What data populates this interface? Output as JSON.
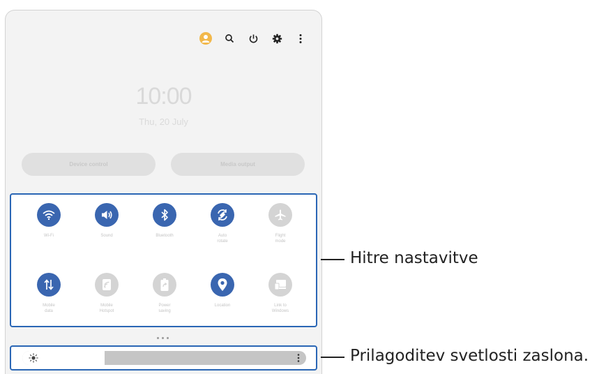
{
  "header_icons": [
    {
      "name": "profile-icon"
    },
    {
      "name": "search-icon"
    },
    {
      "name": "power-icon"
    },
    {
      "name": "gear-icon"
    },
    {
      "name": "more-vertical-icon"
    }
  ],
  "clock": {
    "time": "10:00",
    "date": "Thu, 20 July"
  },
  "pills": {
    "left": "Device control",
    "right": "Media output"
  },
  "quick_settings": {
    "tiles": [
      {
        "label": "Wi-Fi",
        "icon": "wifi-icon",
        "active": true
      },
      {
        "label": "Sound",
        "icon": "sound-icon",
        "active": true
      },
      {
        "label": "Bluetooth",
        "icon": "bluetooth-icon",
        "active": true
      },
      {
        "label": "Auto\nrotate",
        "icon": "auto-rotate-icon",
        "active": true
      },
      {
        "label": "Flight\nmode",
        "icon": "airplane-icon",
        "active": false
      },
      {
        "label": "Mobile\ndata",
        "icon": "mobile-data-icon",
        "active": true
      },
      {
        "label": "Mobile\nHotspot",
        "icon": "hotspot-icon",
        "active": false
      },
      {
        "label": "Power\nsaving",
        "icon": "battery-icon",
        "active": false
      },
      {
        "label": "Location",
        "icon": "location-icon",
        "active": true
      },
      {
        "label": "Link to\nWindows",
        "icon": "link-windows-icon",
        "active": false
      }
    ]
  },
  "brightness": {
    "level": 0.29
  },
  "callouts": {
    "quick_settings": "Hitre nastavitve",
    "brightness": "Prilagoditev svetlosti zaslona."
  },
  "colors": {
    "accent": "#3a66b0",
    "inactive": "#d4d4d4",
    "highlight": "#2a66b5"
  }
}
